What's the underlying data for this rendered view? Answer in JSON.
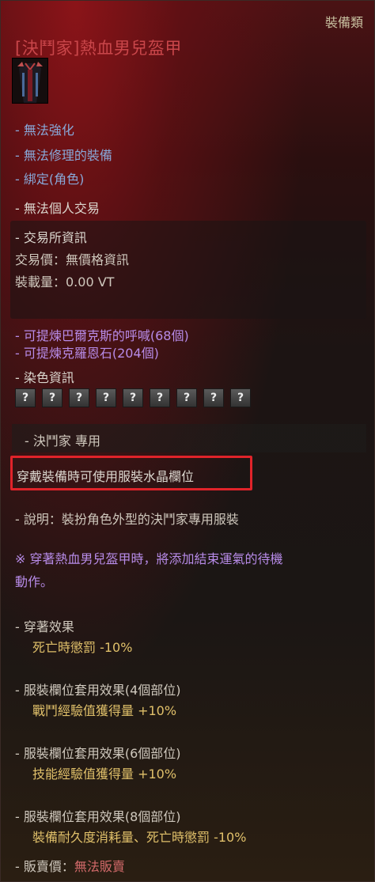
{
  "category": "裝備類",
  "title": "[決鬥家]熱血男兒盔甲",
  "thumbnail_icon": "armor-thumbnail-icon",
  "properties": [
    {
      "text": "- 無法強化"
    },
    {
      "text": "- 無法修理的裝備"
    },
    {
      "text": "- 綁定(角色)"
    }
  ],
  "no_trade": "- 無法個人交易",
  "market": {
    "header": "- 交易所資訊",
    "price": "交易價：無價格資訊",
    "weight": "裝載量：0.00 VT"
  },
  "refine": [
    {
      "text": "- 可提煉巴爾克斯的呼喊(68個)"
    },
    {
      "text": "- 可提煉克羅恩石(204個)"
    }
  ],
  "dye": {
    "header": "- 染色資訊",
    "slots": [
      "?",
      "?",
      "?",
      "?",
      "?",
      "?",
      "?",
      "?",
      "?"
    ]
  },
  "class_only": "- 決鬥家 專用",
  "crystal_note": "穿戴裝備時可使用服裝水晶欄位",
  "description": "- 說明：裝扮角色外型的決鬥家專用服裝",
  "note_line1": "※ 穿著熱血男兒盔甲時，將添加結束運氣的待機",
  "note_line2": "動作。",
  "effects": {
    "wear_header": "- 穿著效果",
    "wear_value": "死亡時懲罰 -10%",
    "set4_header": "- 服裝欄位套用效果(4個部位)",
    "set4_value": "戰鬥經驗值獲得量 +10%",
    "set6_header": "- 服裝欄位套用效果(6個部位)",
    "set6_value": "技能經驗值獲得量 +10%",
    "set8_header": "- 服裝欄位套用效果(8個部位)",
    "set8_value": "裝備耐久度消耗量、死亡時懲罰 -10%"
  },
  "sell": {
    "label": "- 販賣價：",
    "value": "無法販賣"
  },
  "colors": {
    "title": "#c9464a",
    "property_blue": "#88a8d8",
    "refine_purple": "#b78be8",
    "effect_gold": "#e0c06a",
    "highlight_red": "#e0232a"
  }
}
